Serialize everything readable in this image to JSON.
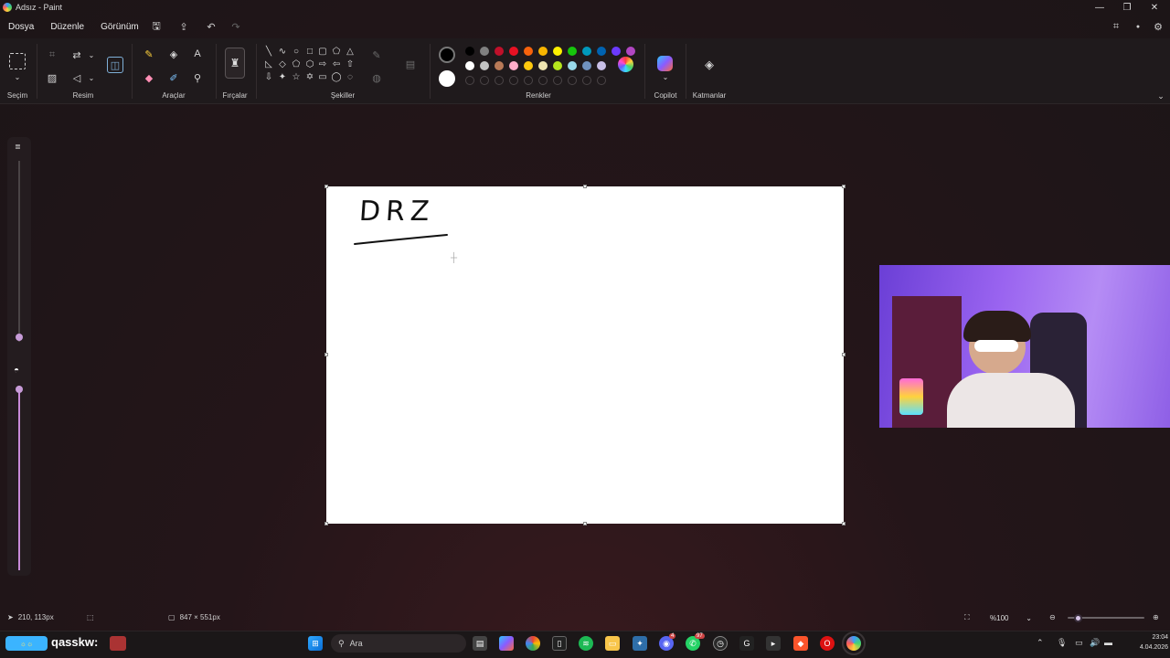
{
  "window": {
    "title": "Adsız - Paint",
    "minimize": "—",
    "maximize": "❐",
    "close": "✕"
  },
  "menu": {
    "items": [
      "Dosya",
      "Düzenle",
      "Görünüm"
    ]
  },
  "ribbon": {
    "groups": {
      "selection": "Seçim",
      "image": "Resim",
      "tools": "Araçlar",
      "brushes": "Fırçalar",
      "shapes": "Şekiller",
      "colors": "Renkler",
      "copilot": "Copilot",
      "layers": "Katmanlar"
    },
    "palette_row1": [
      "#000000",
      "#808080",
      "#c0102a",
      "#e81123",
      "#f7630c",
      "#f7b500",
      "#fff100",
      "#16c60c",
      "#0099bc",
      "#0063b1",
      "#6b3aff",
      "#b146c2"
    ],
    "palette_row2": [
      "#ffffff",
      "#c3c3c3",
      "#b97a57",
      "#ffaec9",
      "#ffc90e",
      "#efe4b0",
      "#b5e61d",
      "#99d9ea",
      "#7092be",
      "#c8bfe7"
    ],
    "primary_color": "#000000",
    "secondary_color": "#ffffff"
  },
  "canvas": {
    "drawn_text": "DRZ"
  },
  "status": {
    "cursor_position": "210, 113px",
    "canvas_size": "847 × 551px",
    "zoom": "%100"
  },
  "taskbar": {
    "widget_text": "qasskw:",
    "search_placeholder": "Ara",
    "clock_time": "23:04",
    "clock_date": "4.04.2026",
    "badge_discord": "4",
    "badge_whatsapp": "97"
  }
}
